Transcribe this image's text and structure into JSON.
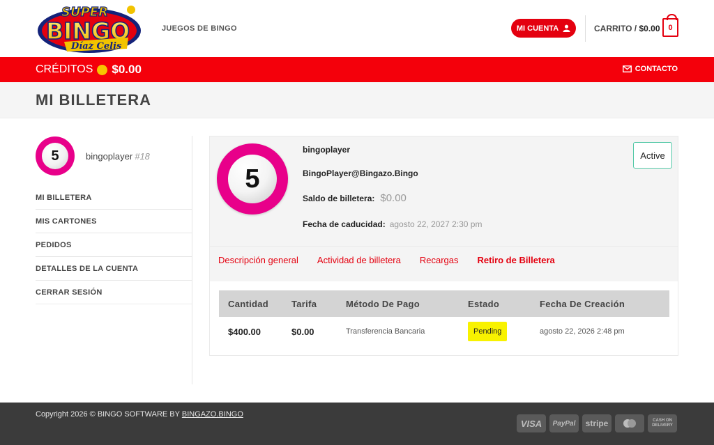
{
  "header": {
    "logo_line1": "SUPER",
    "logo_line2": "BINGO",
    "logo_line3": "Díaz Celis",
    "nav_games": "JUEGOS DE BINGO",
    "account_label": "MI CUENTA",
    "cart_label": "CARRITO /",
    "cart_amount": "$0.00",
    "cart_count": "0"
  },
  "redbar": {
    "credits_label": "CRÉDITOS",
    "credits_amount": "$0.00",
    "contact_label": "CONTACTO"
  },
  "page": {
    "title": "MI BILLETERA"
  },
  "sidebar": {
    "ball_number": "5",
    "username": "bingoplayer",
    "user_id": "#18",
    "menu": [
      "MI BILLETERA",
      "MIS CARTONES",
      "PEDIDOS",
      "DETALLES DE LA CUENTA",
      "CERRAR SESIÓN"
    ]
  },
  "wallet": {
    "ball_number": "5",
    "username": "bingoplayer",
    "email": "BingoPlayer@Bingazo.Bingo",
    "balance_label": "Saldo de billetera:",
    "balance_value": "$0.00",
    "expiry_label": "Fecha de caducidad:",
    "expiry_value": "agosto 22, 2027 2:30 pm",
    "status": "Active",
    "tabs": [
      "Descripción general",
      "Actividad de billetera",
      "Recargas",
      "Retiro de Billetera"
    ],
    "active_tab": "Retiro de Billetera",
    "table": {
      "headers": [
        "Cantidad",
        "Tarifa",
        "Método De Pago",
        "Estado",
        "Fecha De Creación"
      ],
      "rows": [
        [
          "$400.00",
          "$0.00",
          "Transferencia Bancaria",
          "Pending",
          "agosto 22, 2026 2:48 pm"
        ]
      ]
    }
  },
  "footer": {
    "copyright": "Copyright 2026 © BINGO SOFTWARE BY",
    "copyright_link": "BINGAZO.BINGO",
    "payments": [
      "VISA",
      "PayPal",
      "stripe",
      "mastercard",
      "CASH ON DELIVERY"
    ]
  },
  "colors": {
    "brand_red": "#f4000b",
    "ball_pink": "#e8008a",
    "pending_yellow": "#f8f200",
    "active_green": "#4fc7a5"
  }
}
